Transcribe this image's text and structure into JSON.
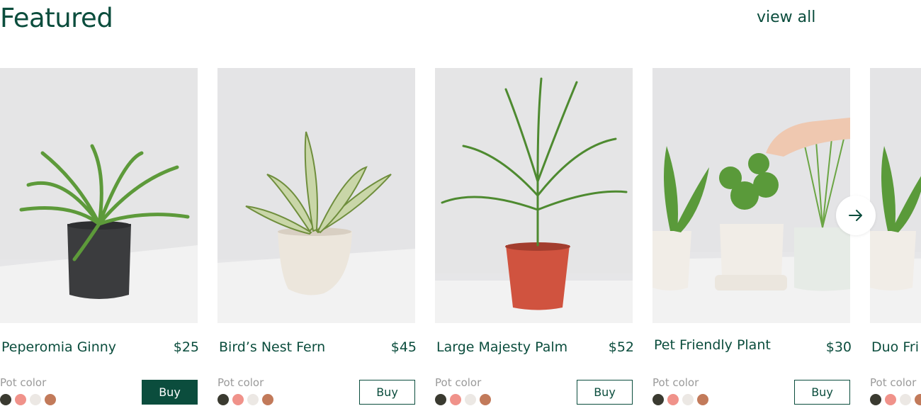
{
  "header": {
    "title": "Featured",
    "view_all": "view all"
  },
  "pot_label": "Pot color",
  "swatch_colors": [
    "#3a3a30",
    "#f0928a",
    "#ece8e4",
    "#c27a5a"
  ],
  "products": [
    {
      "name": "Peperomia Ginny",
      "price": "$25",
      "buy": "Buy"
    },
    {
      "name": "Bird’s Nest Fern",
      "price": "$45",
      "buy": "Buy"
    },
    {
      "name": "Large Majesty Palm",
      "price": "$52",
      "buy": "Buy"
    },
    {
      "name": "Pet Friendly Plant",
      "price": "$30",
      "buy": "Buy"
    },
    {
      "name": "Duo Fri",
      "buy": ""
    }
  ],
  "colors": {
    "brand": "#0b4d3d",
    "muted": "#9a9a9a"
  },
  "icons": {
    "next": "arrow-right-icon"
  }
}
